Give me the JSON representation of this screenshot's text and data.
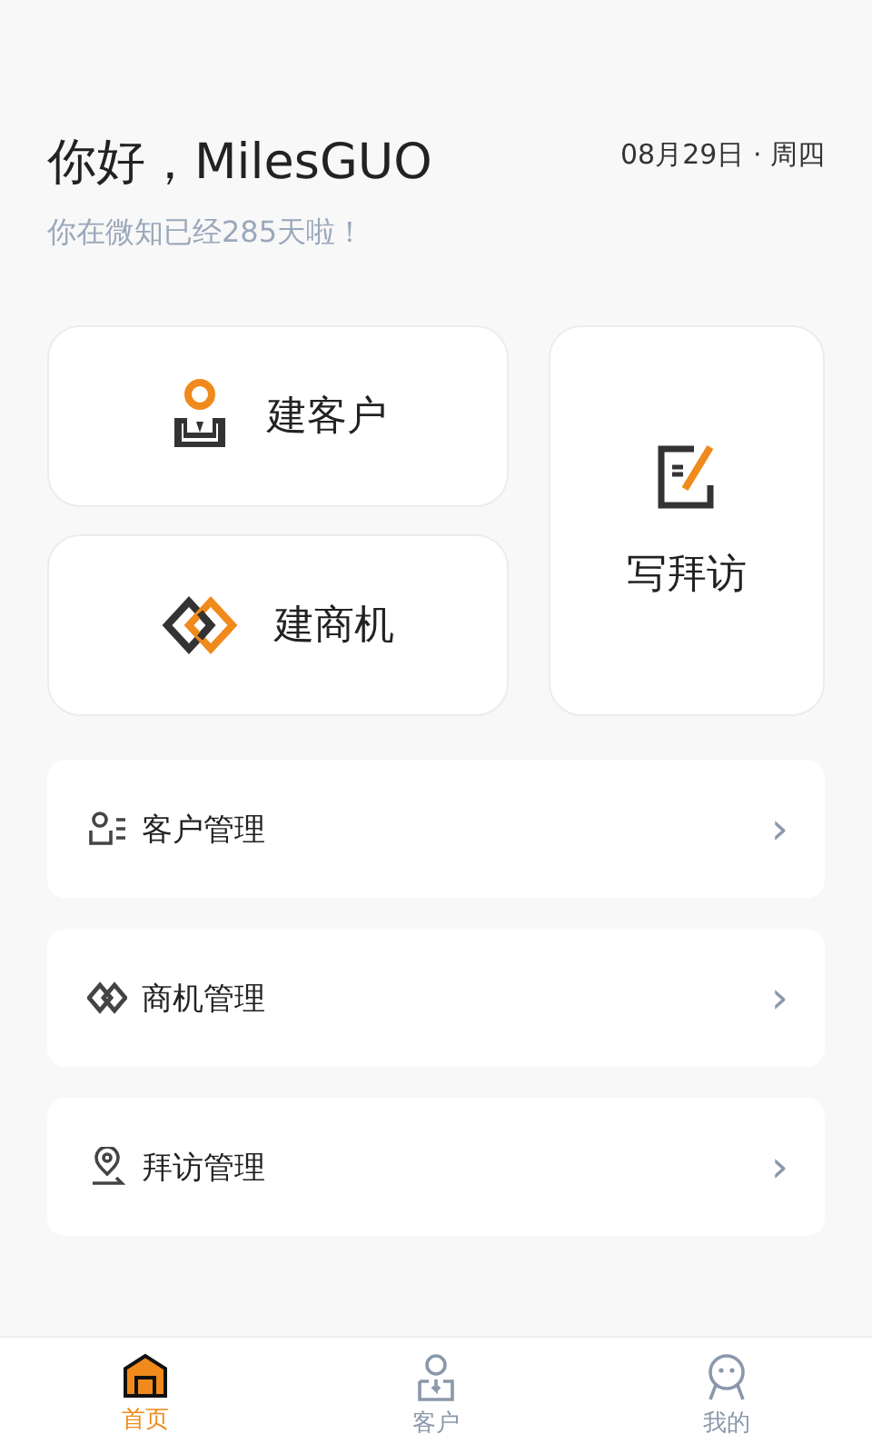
{
  "header": {
    "greeting": "你好，MilesGUO",
    "date": "08月29日 · 周四",
    "subtitle": "你在微知已经285天啦！"
  },
  "quick_actions": [
    {
      "kind": "customer",
      "label": "建客户"
    },
    {
      "kind": "visit",
      "label": "写拜访"
    },
    {
      "kind": "opportunity",
      "label": "建商机"
    }
  ],
  "menu": [
    {
      "kind": "customer",
      "label": "客户管理",
      "chevron": "›"
    },
    {
      "kind": "opportunity",
      "label": "商机管理",
      "chevron": "›"
    },
    {
      "kind": "visit",
      "label": "拜访管理",
      "chevron": "›"
    }
  ],
  "tab_bar": [
    {
      "kind": "home",
      "label": "首页",
      "selected": true
    },
    {
      "kind": "customer",
      "label": "客户",
      "selected": false
    },
    {
      "kind": "me",
      "label": "我的",
      "selected": false
    }
  ]
}
